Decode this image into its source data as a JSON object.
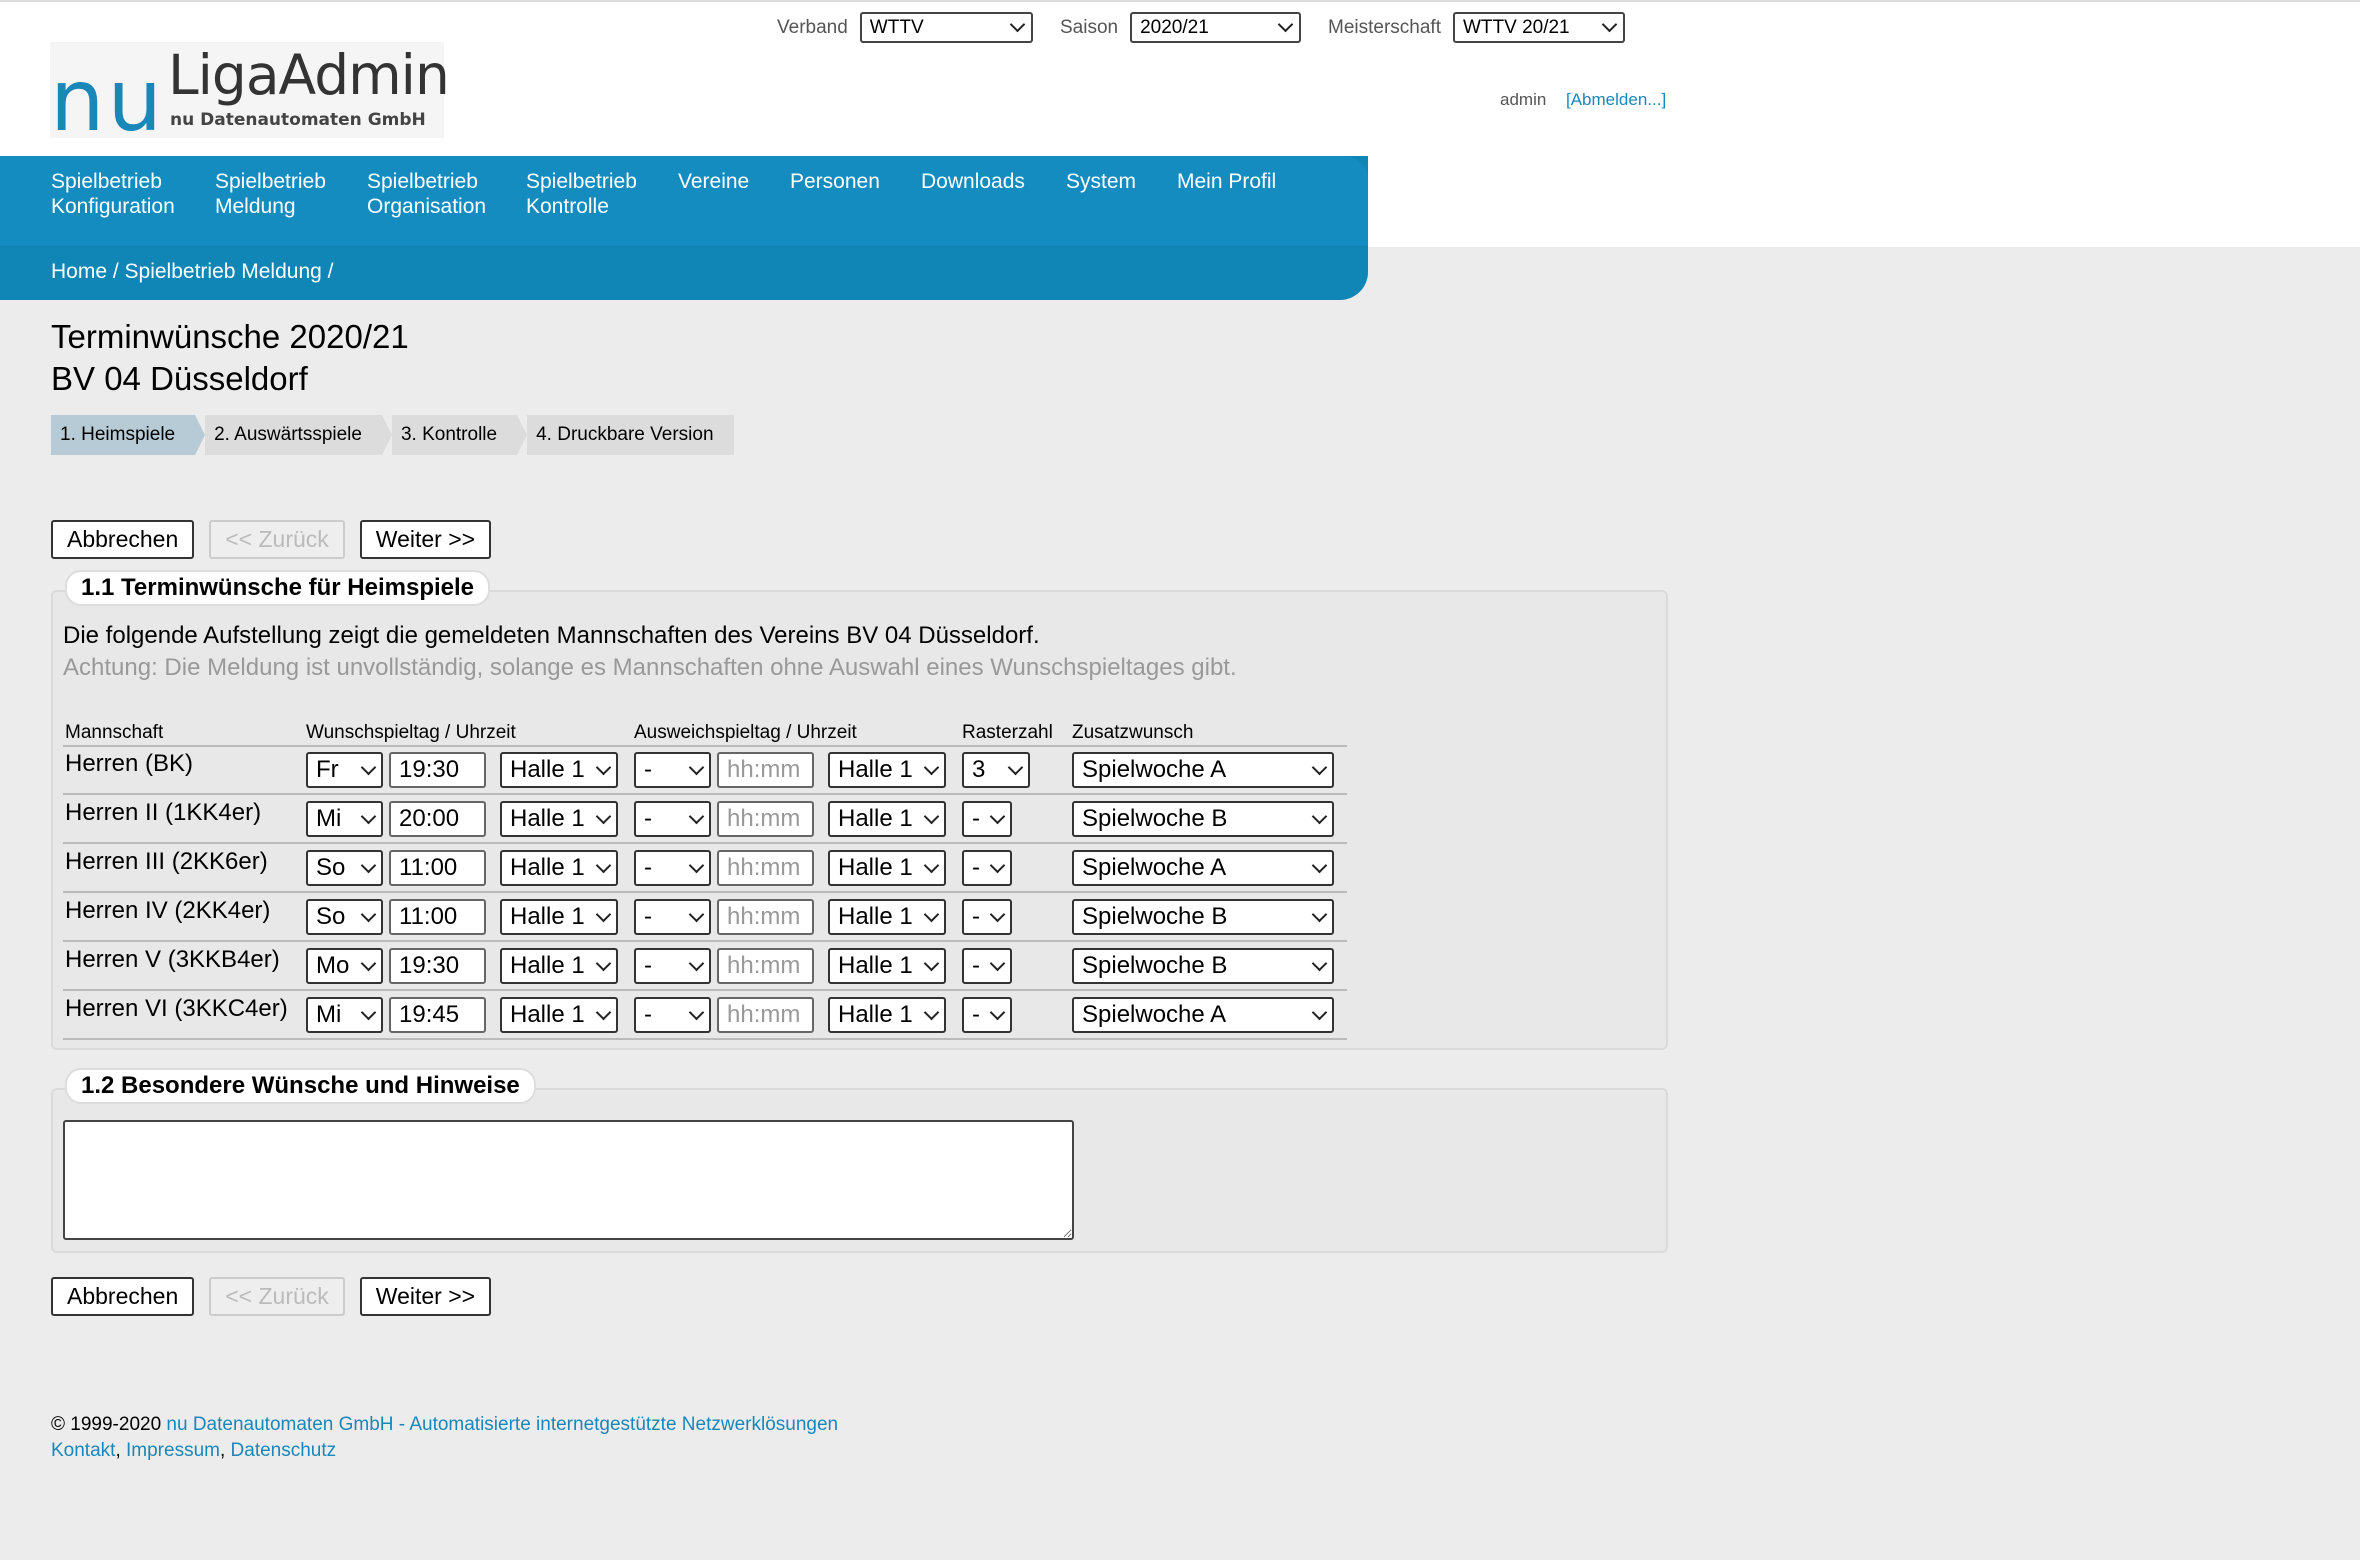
{
  "header": {
    "verband_label": "Verband",
    "verband_value": "WTTV",
    "saison_label": "Saison",
    "saison_value": "2020/21",
    "meisterschaft_label": "Meisterschaft",
    "meisterschaft_value": "WTTV 20/21",
    "logo_nu": "nu",
    "logo_title": "LigaAdmin",
    "logo_sub": "nu Datenautomaten GmbH",
    "user": "admin",
    "logout": "[Abmelden...]"
  },
  "nav": {
    "items": [
      {
        "label": "Spielbetrieb\nKonfiguration",
        "active": false
      },
      {
        "label": "Spielbetrieb\nMeldung",
        "active": true
      },
      {
        "label": "Spielbetrieb\nOrganisation",
        "active": false
      },
      {
        "label": "Spielbetrieb\nKontrolle",
        "active": false
      },
      {
        "label": "Vereine",
        "active": false
      },
      {
        "label": "Personen",
        "active": false
      },
      {
        "label": "Downloads",
        "active": false
      },
      {
        "label": "System",
        "active": false
      },
      {
        "label": "Mein Profil",
        "active": false
      }
    ],
    "breadcrumb": "Home / Spielbetrieb Meldung /"
  },
  "page": {
    "title": "Terminwünsche 2020/21",
    "club": "BV 04 Düsseldorf"
  },
  "steps": [
    "1. Heimspiele",
    "2. Auswärtsspiele",
    "3. Kontrolle",
    "4. Druckbare Version"
  ],
  "buttons": {
    "cancel": "Abbrechen",
    "back": "<< Zurück",
    "next": "Weiter >>"
  },
  "section1": {
    "legend": "1.1 Terminwünsche für Heimspiele",
    "intro": "Die folgende Aufstellung zeigt die gemeldeten Mannschaften des Vereins BV 04 Düsseldorf.",
    "warning": "Achtung: Die Meldung ist unvollständig, solange es Mannschaften ohne Auswahl eines Wunschspieltages gibt.",
    "columns": [
      "Mannschaft",
      "Wunschspieltag / Uhrzeit",
      "Ausweichspieltag / Uhrzeit",
      "Rasterzahl",
      "Zusatzwunsch"
    ],
    "rows": [
      {
        "team": "Herren (BK)",
        "day": "Fr",
        "time": "19:30",
        "hall": "Halle 1",
        "alt_day": "-",
        "alt_time": "hh:mm",
        "alt_hall": "Halle 1",
        "raster": "3",
        "extra": "Spielwoche A"
      },
      {
        "team": "Herren II (1KK4er)",
        "day": "Mi",
        "time": "20:00",
        "hall": "Halle 1",
        "alt_day": "-",
        "alt_time": "hh:mm",
        "alt_hall": "Halle 1",
        "raster": "-",
        "extra": "Spielwoche B"
      },
      {
        "team": "Herren III (2KK6er)",
        "day": "So",
        "time": "11:00",
        "hall": "Halle 1",
        "alt_day": "-",
        "alt_time": "hh:mm",
        "alt_hall": "Halle 1",
        "raster": "-",
        "extra": "Spielwoche A"
      },
      {
        "team": "Herren IV (2KK4er)",
        "day": "So",
        "time": "11:00",
        "hall": "Halle 1",
        "alt_day": "-",
        "alt_time": "hh:mm",
        "alt_hall": "Halle 1",
        "raster": "-",
        "extra": "Spielwoche B"
      },
      {
        "team": "Herren V (3KKB4er)",
        "day": "Mo",
        "time": "19:30",
        "hall": "Halle 1",
        "alt_day": "-",
        "alt_time": "hh:mm",
        "alt_hall": "Halle 1",
        "raster": "-",
        "extra": "Spielwoche B"
      },
      {
        "team": "Herren VI (3KKC4er)",
        "day": "Mi",
        "time": "19:45",
        "hall": "Halle 1",
        "alt_day": "-",
        "alt_time": "hh:mm",
        "alt_hall": "Halle 1",
        "raster": "-",
        "extra": "Spielwoche A"
      }
    ]
  },
  "section2": {
    "legend": "1.2 Besondere Wünsche und Hinweise",
    "notes": ""
  },
  "footer": {
    "copyright": "© 1999-2020 ",
    "company": "nu Datenautomaten GmbH - Automatisierte internetgestützte Netzwerklösungen",
    "links": [
      "Kontakt",
      "Impressum",
      "Datenschutz"
    ]
  },
  "colors": {
    "nav": "#148cbf",
    "link": "#1a87b9",
    "background": "#ececec",
    "step_active": "#b7cbd6"
  }
}
